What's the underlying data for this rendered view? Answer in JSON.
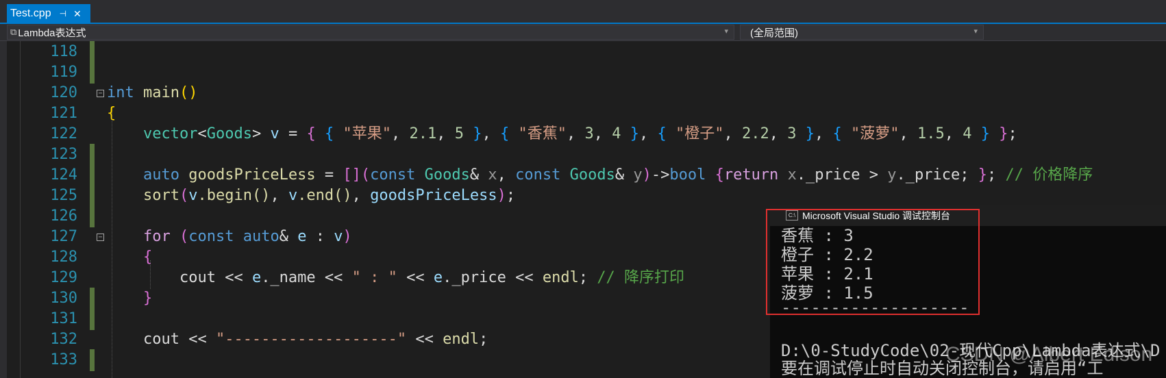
{
  "tab": {
    "title": "Test.cpp",
    "pin_icon": "pin-icon",
    "close_icon": "close-icon"
  },
  "navbar": {
    "scope_left": "Lambda表达式",
    "scope_right": "(全局范围)"
  },
  "line_numbers": [
    "118",
    "119",
    "120",
    "121",
    "122",
    "123",
    "124",
    "125",
    "126",
    "127",
    "128",
    "129",
    "130",
    "131",
    "132",
    "133"
  ],
  "code": {
    "l120": {
      "kw": "int",
      "fn": "main",
      "paren": "()"
    },
    "l121": {
      "brace": "{"
    },
    "l122": {
      "type1": "vector",
      "lt": "<",
      "type2": "Goods",
      "gt": ">",
      "var": "v",
      "eq": " = ",
      "items": [
        {
          "name": "\"苹果\"",
          "price": "2.1",
          "count": "5"
        },
        {
          "name": "\"香蕉\"",
          "price": "3",
          "count": "4"
        },
        {
          "name": "\"橙子\"",
          "price": "2.2",
          "count": "3"
        },
        {
          "name": "\"菠萝\"",
          "price": "1.5",
          "count": "4"
        }
      ]
    },
    "l124": {
      "kw_auto": "auto",
      "name": "goodsPriceLess",
      "eq": " = ",
      "capture": "[]",
      "const1": "const",
      "type1": "Goods",
      "amp1": "&",
      "p1": "x",
      "const2": "const",
      "type2": "Goods",
      "amp2": "&",
      "p2": "y",
      "arrow": "->",
      "ret": "bool",
      "return_kw": "return",
      "body_x": "x",
      "member": "._price",
      "gt": " > ",
      "body_y": "y",
      "member2": "._price",
      "semi": ";",
      "tail": ";",
      "comment": "// 价格降序"
    },
    "l125": {
      "fn": "sort",
      "v1": "v",
      "begin": ".begin()",
      "v2": "v",
      "end": ".end()",
      "arg": "goodsPriceLess",
      "tail": ";"
    },
    "l127": {
      "kw": "for",
      "const": "const",
      "auto": "auto",
      "amp": "&",
      "e": "e",
      "colon": " : ",
      "v": "v"
    },
    "l128": {
      "brace": "{"
    },
    "l129": {
      "cout": "cout",
      "op1": " << ",
      "e1": "e",
      "name": "._name",
      "op2": " << ",
      "str": "\" : \"",
      "op3": " << ",
      "e2": "e",
      "price": "._price",
      "op4": " << ",
      "endl": "endl",
      "semi": ";",
      "comment": "// 降序打印"
    },
    "l130": {
      "brace": "}"
    },
    "l132": {
      "cout": "cout",
      "op1": " << ",
      "str": "\"-------------------\"",
      "op2": " << ",
      "endl": "endl",
      "semi": ";"
    }
  },
  "console": {
    "title": "Microsoft Visual Studio 调试控制台",
    "icon_text": "C:\\",
    "lines": [
      "香蕉 : 3",
      "橙子 : 2.2",
      "苹果 : 2.1",
      "菠萝 : 1.5",
      "-------------------",
      "",
      "D:\\0-StudyCode\\02-现代Cpp\\Lambda表达式\\D",
      "要在调试停止时自动关闭控制台，请启用“工"
    ]
  },
  "watermark": "CSDN @Albert Edison"
}
